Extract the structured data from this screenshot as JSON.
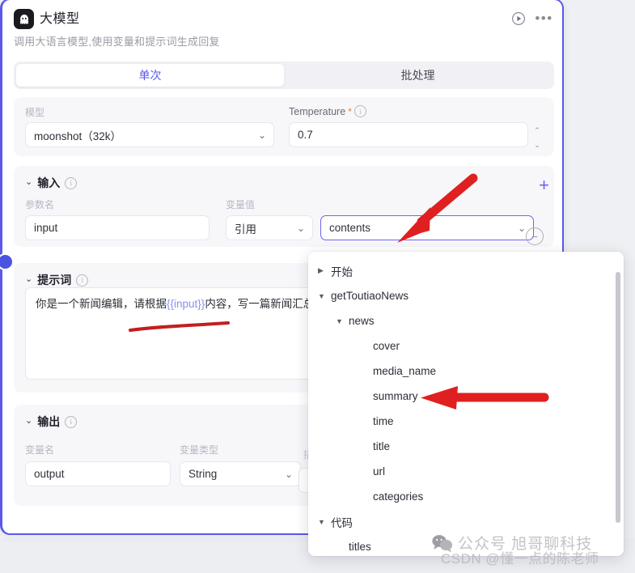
{
  "node": {
    "title": "大模型",
    "subtitle": "调用大语言模型,使用变量和提示词生成回复",
    "avatar_icon": "robot-face-icon",
    "run_icon": "play-circle-icon",
    "more_icon": "ellipsis-icon"
  },
  "tabs": [
    {
      "label": "单次",
      "active": true
    },
    {
      "label": "批处理",
      "active": false
    }
  ],
  "model_section": {
    "model_label": "模型",
    "model_value": "moonshot（32k）",
    "temperature_label": "Temperature",
    "temperature_required": "*",
    "temperature_value": "0.7"
  },
  "input_section": {
    "title": "输入",
    "add_label": "+",
    "col_param_name": "参数名",
    "col_var_value": "变量值",
    "rows": [
      {
        "param_name": "input",
        "ref_type": "引用",
        "value": "contents",
        "remove_label": "−"
      }
    ]
  },
  "prompt_section": {
    "title": "提示词",
    "text_before": "你是一个新闻编辑，请根据",
    "variable": "{{input}}",
    "text_after": "内容，写一篇新闻汇总"
  },
  "output_section": {
    "title": "输出",
    "col_var_name": "变量名",
    "col_var_type": "变量类型",
    "col_desc": "描述",
    "rows": [
      {
        "var_name": "output",
        "var_type": "String"
      }
    ]
  },
  "dropdown": {
    "items": [
      {
        "label": "开始",
        "level": 1,
        "toggle": "closed"
      },
      {
        "label": "getToutiaoNews",
        "level": 1,
        "toggle": "open"
      },
      {
        "label": "news",
        "level": 2,
        "toggle": "open"
      },
      {
        "label": "cover",
        "level": 3,
        "toggle": "none"
      },
      {
        "label": "media_name",
        "level": 3,
        "toggle": "none"
      },
      {
        "label": "summary",
        "level": 3,
        "toggle": "none"
      },
      {
        "label": "time",
        "level": 3,
        "toggle": "none"
      },
      {
        "label": "title",
        "level": 3,
        "toggle": "none"
      },
      {
        "label": "url",
        "level": 3,
        "toggle": "none"
      },
      {
        "label": "categories",
        "level": 3,
        "toggle": "none"
      },
      {
        "label": "代码",
        "level": 1,
        "toggle": "open"
      },
      {
        "label": "titles",
        "level": 2,
        "toggle": "none"
      }
    ]
  },
  "annotations": {
    "arrow_to_contents": "red-arrow-diagonal",
    "arrow_to_summary": "red-arrow-horizontal",
    "underline_prompt": "red-underline"
  },
  "watermarks": {
    "wechat": "公众号 旭哥聊科技",
    "csdn": "CSDN @懂一点的陈老师"
  },
  "colors": {
    "accent": "#5b58eb",
    "annotation": "#e02020",
    "panel_bg": "#ffffff",
    "card_bg": "#f7f7fa"
  }
}
